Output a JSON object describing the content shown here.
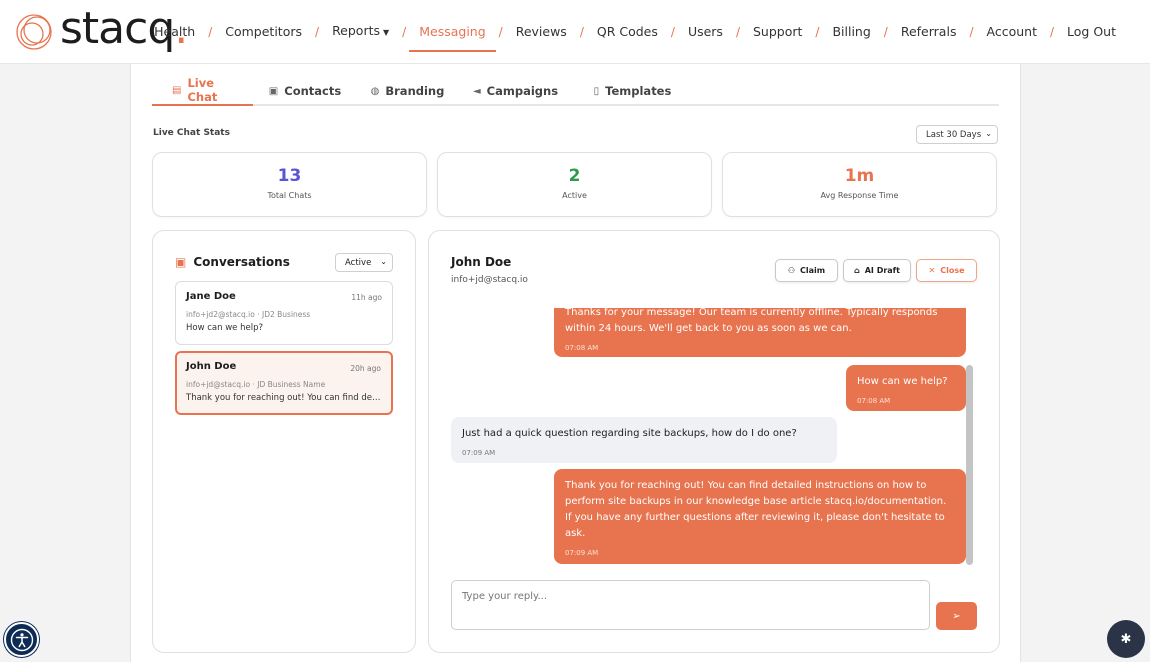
{
  "logo": {
    "text": "stacq",
    "dot": "."
  },
  "nav": {
    "items": [
      {
        "label": "Health"
      },
      {
        "label": "Competitors"
      },
      {
        "label": "Reports",
        "has_caret": true
      },
      {
        "label": "Messaging",
        "active": true
      },
      {
        "label": "Reviews"
      },
      {
        "label": "QR Codes"
      },
      {
        "label": "Users"
      },
      {
        "label": "Support"
      },
      {
        "label": "Billing"
      },
      {
        "label": "Referrals"
      },
      {
        "label": "Account"
      },
      {
        "label": "Log Out"
      }
    ],
    "separator": "/"
  },
  "tabs": [
    {
      "label": "Live Chat",
      "icon": "chat-icon",
      "active": true
    },
    {
      "label": "Contacts",
      "icon": "contacts-icon"
    },
    {
      "label": "Branding",
      "icon": "palette-icon"
    },
    {
      "label": "Campaigns",
      "icon": "megaphone-icon"
    },
    {
      "label": "Templates",
      "icon": "document-icon"
    }
  ],
  "stats": {
    "title": "Live Chat Stats",
    "range": "Last 30 Days",
    "cards": [
      {
        "value": "13",
        "label": "Total Chats",
        "color": "#5a55d2"
      },
      {
        "value": "2",
        "label": "Active",
        "color": "#2e9a4a"
      },
      {
        "value": "1m",
        "label": "Avg Response Time",
        "color": "#e8734f"
      }
    ]
  },
  "conversations": {
    "title": "Conversations",
    "filter": "Active",
    "items": [
      {
        "name": "Jane Doe",
        "time": "11h ago",
        "meta": "info+jd2@stacq.io · JD2 Business",
        "preview": "How can we help?"
      },
      {
        "name": "John Doe",
        "time": "20h ago",
        "meta": "info+jd@stacq.io · JD Business Name",
        "preview": "Thank you for reaching out! You can find detailed instructions",
        "selected": true
      }
    ]
  },
  "chat": {
    "name": "John Doe",
    "email": "info+jd@stacq.io",
    "actions": {
      "claim": "Claim",
      "ai_draft": "AI Draft",
      "close": "Close"
    },
    "messages": [
      {
        "dir": "out",
        "text": "Thanks for your message! Our team is currently offline. Typically responds within 24 hours. We'll get back to you as soon as we can.",
        "time": "07:08 AM"
      },
      {
        "dir": "out",
        "text": "How can we help?",
        "time": "07:08 AM"
      },
      {
        "dir": "in",
        "text": "Just had a quick question regarding site backups, how do I do one?",
        "time": "07:09 AM"
      },
      {
        "dir": "out",
        "text": "Thank you for reaching out! You can find detailed instructions on how to perform site backups in our knowledge base article stacq.io/documentation. If you have any further questions after reviewing it, please don't hesitate to ask.",
        "time": "07:09 AM"
      }
    ],
    "reply_placeholder": "Type your reply..."
  },
  "colors": {
    "accent": "#e8734f",
    "accessibility_bg": "#0d2b55",
    "bug_bg": "#2b3447"
  }
}
